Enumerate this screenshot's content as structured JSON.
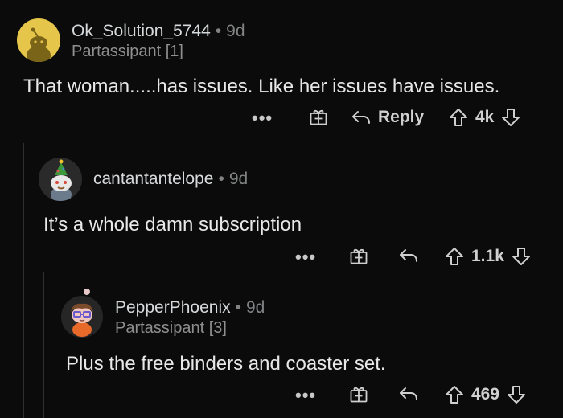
{
  "comments": [
    {
      "username": "Ok_Solution_5744",
      "age": "9d",
      "flair": "Partassipant [1]",
      "text": "That woman.....has issues. Like her issues have issues.",
      "reply_label": "Reply",
      "score": "4k",
      "more_label": "•••"
    },
    {
      "username": "cantantantelope",
      "age": "9d",
      "text": "It’s a whole damn subscription",
      "score": "1.1k",
      "more_label": "•••"
    },
    {
      "username": "PepperPhoenix",
      "age": "9d",
      "flair": "Partassipant [3]",
      "text": "Plus the free binders and coaster set.",
      "score": "469",
      "more_label": "•••"
    }
  ],
  "separator": "•",
  "colors": {
    "background": "#0b0b0b",
    "text": "#d7dadc",
    "muted": "#818384",
    "thread_line": "#2f2f2f",
    "avatar_yellow": "#e6c64a"
  },
  "icons": [
    "snoo-avatar-icon",
    "gift-icon",
    "reply-arrow-icon",
    "upvote-icon",
    "downvote-icon"
  ]
}
